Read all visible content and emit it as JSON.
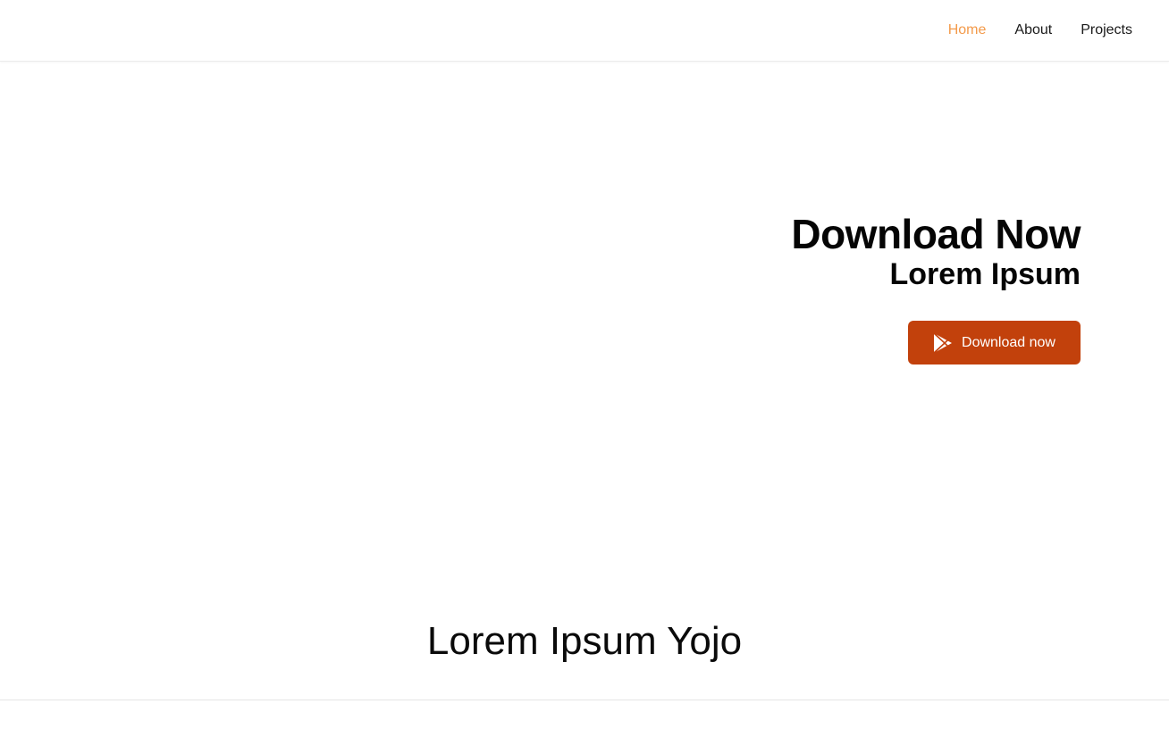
{
  "nav": {
    "links": [
      {
        "label": "Home",
        "active": true
      },
      {
        "label": "About",
        "active": false
      },
      {
        "label": "Projects",
        "active": false
      }
    ]
  },
  "hero": {
    "title": "Download Now",
    "subtitle": "Lorem Ipsum",
    "button_label": "Download now",
    "button_icon": "play-store-icon"
  },
  "section": {
    "heading": "Lorem Ipsum Yojo"
  },
  "colors": {
    "accent": "#c2410c",
    "active_link": "#f39a4a"
  }
}
